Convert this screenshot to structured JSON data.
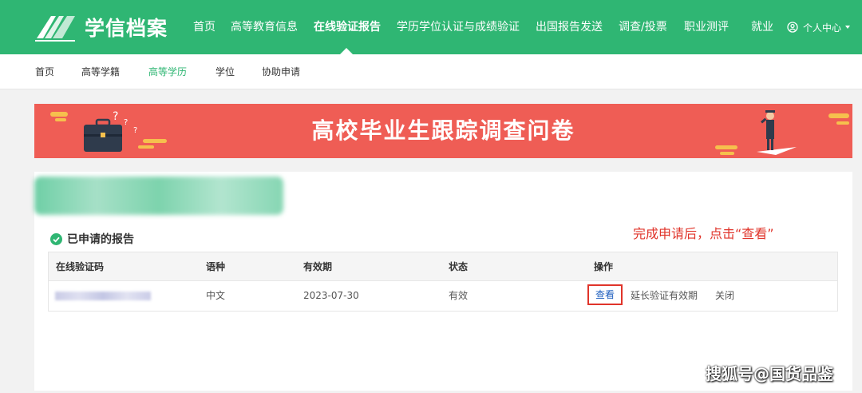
{
  "header": {
    "logo_text": "学信档案",
    "nav": [
      {
        "label": "首页"
      },
      {
        "label": "高等教育信息"
      },
      {
        "label": "在线验证报告"
      },
      {
        "label": "学历学位认证与成绩验证"
      },
      {
        "label": "出国报告发送"
      },
      {
        "label": "调查/投票"
      },
      {
        "label": "职业测评"
      },
      {
        "label": "就业"
      }
    ],
    "active_nav": "在线验证报告",
    "user_menu_label": "个人中心"
  },
  "subnav": {
    "items": [
      {
        "label": "首页"
      },
      {
        "label": "高等学籍"
      },
      {
        "label": "高等学历"
      },
      {
        "label": "学位"
      },
      {
        "label": "协助申请"
      }
    ],
    "active": "高等学历"
  },
  "banner": {
    "title": "高校毕业生跟踪调查问卷",
    "color": "#ef5d55"
  },
  "reports": {
    "section_title": "已申请的报告",
    "annotation": "完成申请后，点击“查看”",
    "columns": [
      "在线验证码",
      "语种",
      "有效期",
      "状态",
      "操作"
    ],
    "rows": [
      {
        "language": "中文",
        "valid_until": "2023-07-30",
        "status": "有效",
        "actions": {
          "view": "查看",
          "extend": "延长验证有效期",
          "close": "关闭"
        }
      }
    ]
  },
  "watermark": "搜狐号@国货品鉴",
  "colors": {
    "brand_green": "#2fb673",
    "annotation_red": "#e0342a",
    "link_blue": "#1f5fbf"
  }
}
